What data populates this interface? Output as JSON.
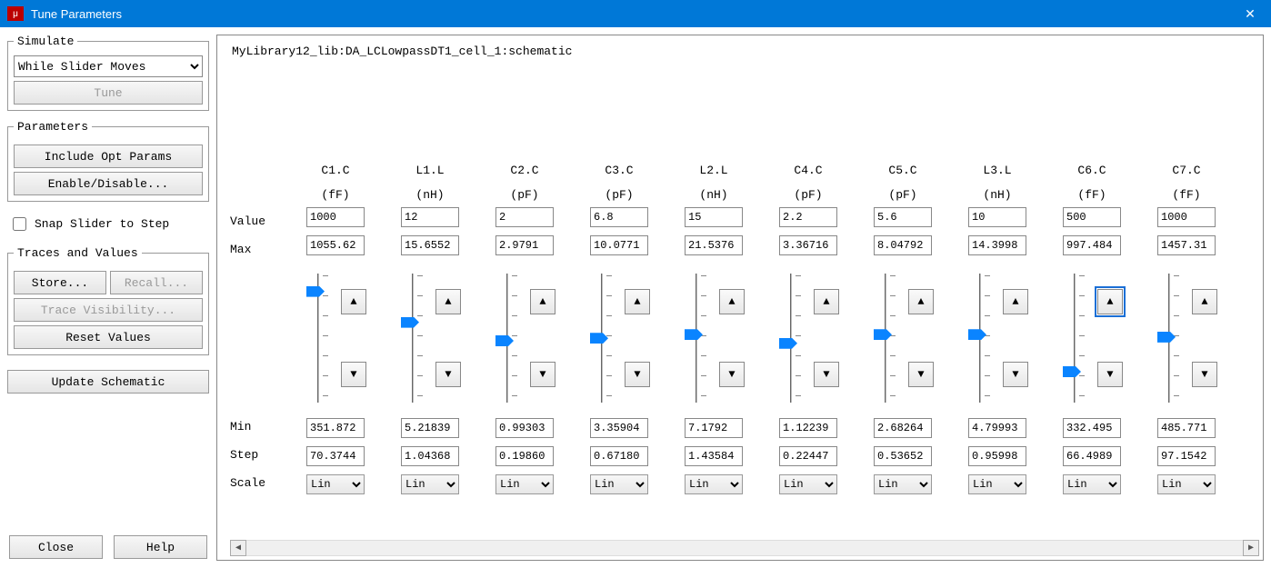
{
  "window": {
    "title": "Tune Parameters"
  },
  "left": {
    "simulate": {
      "legend": "Simulate",
      "mode": "While Slider Moves",
      "tune_btn": "Tune"
    },
    "parameters": {
      "legend": "Parameters",
      "include_opt": "Include Opt Params",
      "enable_disable": "Enable/Disable..."
    },
    "snap_label": "Snap Slider to Step",
    "traces": {
      "legend": "Traces and Values",
      "store": "Store...",
      "recall": "Recall...",
      "trace_vis": "Trace Visibility...",
      "reset": "Reset Values"
    },
    "update_btn": "Update Schematic",
    "close": "Close",
    "help": "Help"
  },
  "right": {
    "path": "MyLibrary12_lib:DA_LCLowpassDT1_cell_1:schematic",
    "row_labels": {
      "value": "Value",
      "max": "Max",
      "min": "Min",
      "step": "Step",
      "scale": "Scale"
    },
    "scale_option": "Lin",
    "columns": [
      {
        "name": "C1.C",
        "unit": "(fF)",
        "value": "1000",
        "max": "1055.62",
        "min": "351.872",
        "step": "70.3744",
        "thumb_pct": 10,
        "active_up": false
      },
      {
        "name": "L1.L",
        "unit": "(nH)",
        "value": "12",
        "max": "15.6552",
        "min": "5.21839",
        "step": "1.04368",
        "thumb_pct": 35,
        "active_up": false
      },
      {
        "name": "C2.C",
        "unit": "(pF)",
        "value": "2",
        "max": "2.9791",
        "min": "0.99303",
        "step": "0.19860",
        "thumb_pct": 50,
        "active_up": false
      },
      {
        "name": "C3.C",
        "unit": "(pF)",
        "value": "6.8",
        "max": "10.0771",
        "min": "3.35904",
        "step": "0.67180",
        "thumb_pct": 48,
        "active_up": false
      },
      {
        "name": "L2.L",
        "unit": "(nH)",
        "value": "15",
        "max": "21.5376",
        "min": "7.1792",
        "step": "1.43584",
        "thumb_pct": 45,
        "active_up": false
      },
      {
        "name": "C4.C",
        "unit": "(pF)",
        "value": "2.2",
        "max": "3.36716",
        "min": "1.12239",
        "step": "0.22447",
        "thumb_pct": 52,
        "active_up": false
      },
      {
        "name": "C5.C",
        "unit": "(pF)",
        "value": "5.6",
        "max": "8.04792",
        "min": "2.68264",
        "step": "0.53652",
        "thumb_pct": 45,
        "active_up": false
      },
      {
        "name": "L3.L",
        "unit": "(nH)",
        "value": "10",
        "max": "14.3998",
        "min": "4.79993",
        "step": "0.95998",
        "thumb_pct": 45,
        "active_up": false
      },
      {
        "name": "C6.C",
        "unit": "(fF)",
        "value": "500",
        "max": "997.484",
        "min": "332.495",
        "step": "66.4989",
        "thumb_pct": 75,
        "active_up": true
      },
      {
        "name": "C7.C",
        "unit": "(fF)",
        "value": "1000",
        "max": "1457.31",
        "min": "485.771",
        "step": "97.1542",
        "thumb_pct": 47,
        "active_up": false
      }
    ]
  }
}
